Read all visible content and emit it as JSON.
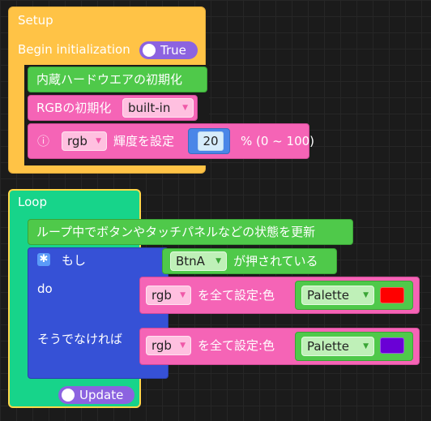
{
  "setup": {
    "title": "Setup",
    "begin_label": "Begin initialization",
    "begin_value": "True",
    "init_hardware": "内蔵ハードウエアの初期化",
    "rgb_init_label": "RGBの初期化",
    "rgb_init_option": "built-in",
    "info_icon": "ⓘ",
    "rgb_var": "rgb",
    "brightness_label": "輝度を設定",
    "brightness_value": "20",
    "brightness_range": "% (0 ~ 100)"
  },
  "loop": {
    "title": "Loop",
    "comment": "ループ中でボタンやタッチパネルなどの状態を更新",
    "if_label": "もし",
    "button_option": "BtnA",
    "pressed_label": "が押されている",
    "do_label": "do",
    "else_label": "そうでなければ",
    "set_all_1": {
      "var": "rgb",
      "label": "を全て設定:色",
      "palette": "Palette",
      "color": "#ff0000"
    },
    "set_all_2": {
      "var": "rgb",
      "label": "を全て設定:色",
      "palette": "Palette",
      "color": "#6a00d6"
    },
    "update_label": "Update"
  }
}
